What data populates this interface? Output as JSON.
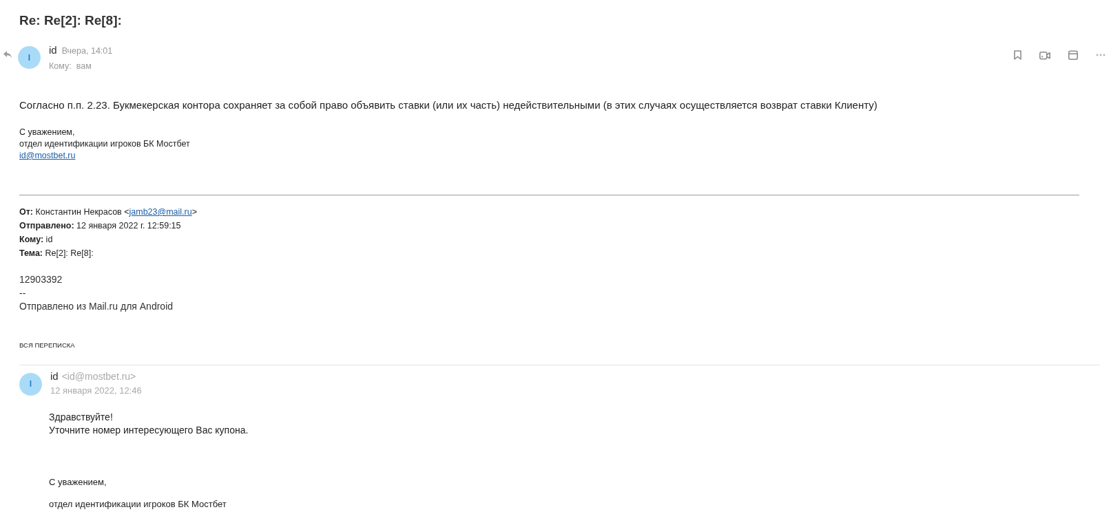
{
  "subject": "Re: Re[2]: Re[8]:",
  "message": {
    "avatar_letter": "I",
    "sender": "id",
    "time": "Вчера, 14:01",
    "to_label": "Кому:",
    "to": "вам",
    "body": "Согласно п.п. 2.23. Букмекерская контора сохраняет за собой право объявить ставки (или их часть) недействительными (в этих случаях осуществляется возврат ставки Клиенту)",
    "signature": [
      "С уважением,",
      "отдел идентификации игроков БК Мостбет"
    ],
    "signature_link": "id@mostbet.ru"
  },
  "quoted": {
    "header_lines": [
      {
        "text": "**От:** Константин Некрасов <",
        "link": "jamb23@mail.ru",
        "after": ">"
      },
      {
        "text": "**Отправлено:** 12 января 2022 г. 12:59:15"
      },
      {
        "text": "**Кому:** id"
      },
      {
        "text": "**Тема:** Re[2]: Re[8]:"
      }
    ],
    "body_lines": [
      "12903392",
      "--",
      "Отправлено из Mail.ru для Android"
    ]
  },
  "thread_label": "ВСЯ ПЕРЕПИСКА",
  "thread_message": {
    "avatar_letter": "I",
    "sender": "id",
    "address": "<id@mostbet.ru>",
    "date": "12 января 2022, 12:46",
    "body_lines": [
      "Здравствуйте!",
      "Уточните номер интересующего Вас купона."
    ],
    "signature": [
      "С уважением,",
      "отдел идентификации игроков БК Мостбет"
    ]
  }
}
